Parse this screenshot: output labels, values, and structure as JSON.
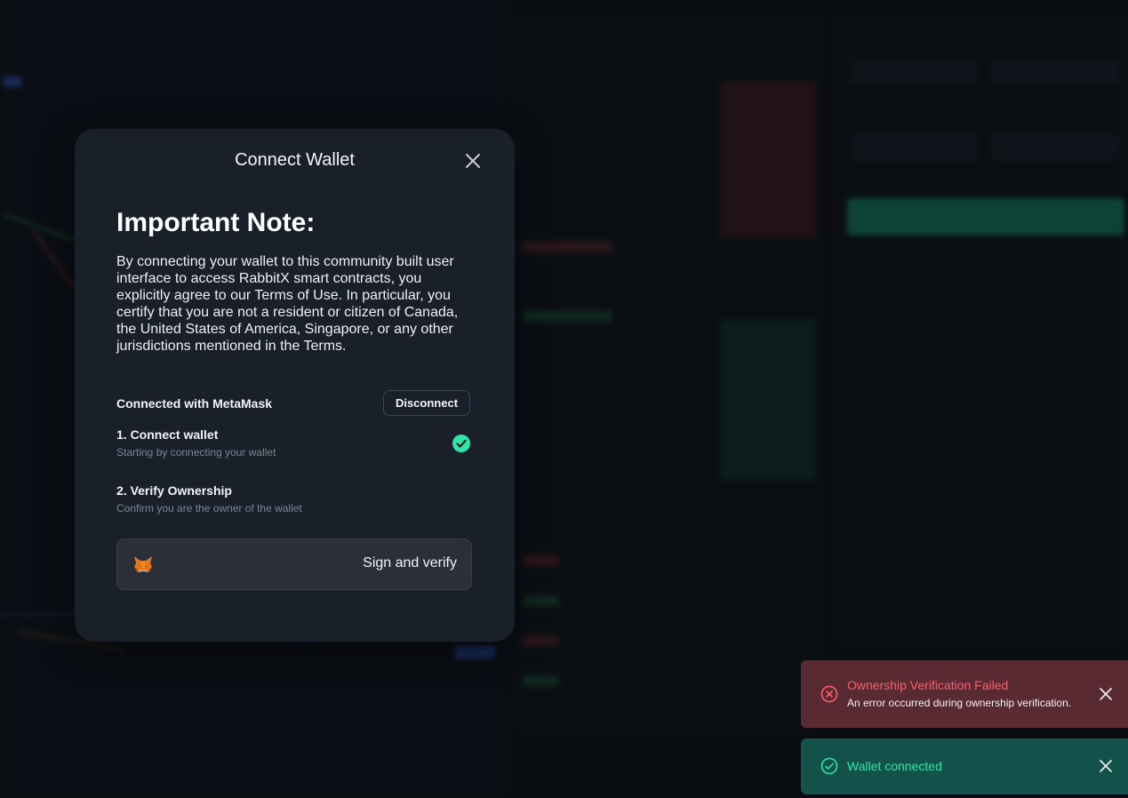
{
  "modal": {
    "title": "Connect Wallet",
    "close_icon": "close-icon",
    "note_heading": "Important Note:",
    "note_body": "By connecting your wallet to this community built user interface to access RabbitX smart contracts, you explicitly agree to our Terms of Use. In particular, you certify that you are not a resident or citizen of Canada, the United States of America, Singapore, or any other jurisdictions mentioned in the Terms.",
    "connected_label": "Connected with MetaMask",
    "disconnect_label": "Disconnect",
    "steps": [
      {
        "title": "1. Connect wallet",
        "subtitle": "Starting by connecting your wallet",
        "status": "complete"
      },
      {
        "title": "2. Verify Ownership",
        "subtitle": "Confirm you are the owner of the wallet",
        "status": "pending"
      }
    ],
    "sign_button_label": "Sign and verify",
    "sign_button_icon": "metamask-fox-icon"
  },
  "toasts": [
    {
      "type": "error",
      "title": "Ownership Verification Failed",
      "message": "An error occurred during ownership verification.",
      "icon": "error-circle-icon"
    },
    {
      "type": "success",
      "title": "Wallet connected",
      "icon": "check-circle-icon"
    }
  ],
  "colors": {
    "accent_success": "#2ee6a8",
    "accent_error": "#ff5c6c",
    "modal_bg": "#19202a",
    "page_bg": "#0d1117"
  }
}
